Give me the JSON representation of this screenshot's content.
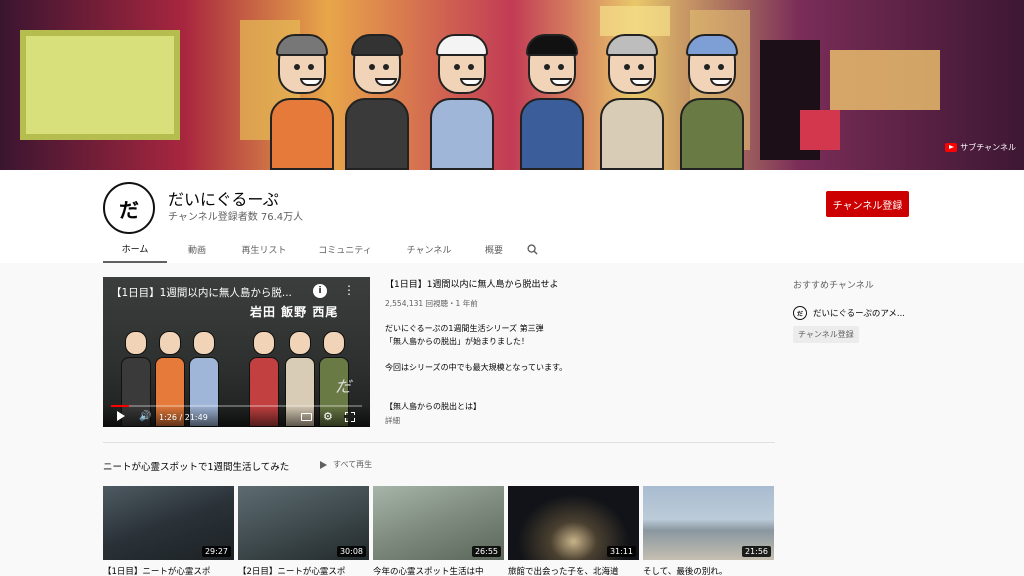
{
  "banner": {
    "sub_channel_label": "サブチャンネル"
  },
  "channel": {
    "name": "だいにぐるーぷ",
    "subscribers": "チャンネル登録者数 76.4万人",
    "subscribe_label": "チャンネル登録",
    "avatar_text": "だ"
  },
  "tabs": [
    {
      "label": "ホーム",
      "active": true
    },
    {
      "label": "動画"
    },
    {
      "label": "再生リスト"
    },
    {
      "label": "コミュニティ"
    },
    {
      "label": "チャンネル"
    },
    {
      "label": "概要"
    }
  ],
  "featured": {
    "overlay_title": "【1日目】1週間以内に無人島から脱...",
    "names": "岩田 飯野 西尾",
    "time": "1:26 / 21:49",
    "progress_fraction": 0.07,
    "title": "【1日目】1週間以内に無人島から脱出せよ",
    "meta": "2,554,131 回視聴・1 年前",
    "desc": [
      "だいにぐるーぷの1週間生活シリーズ 第三弾",
      "「無人島からの脱出」が始まりました！",
      "",
      "今回はシリーズの中でも最大規模となっています。",
      "",
      "",
      "【無人島からの脱出とは】"
    ],
    "more_label": "詳細"
  },
  "playlist": {
    "title": "ニートが心霊スポットで1週間生活してみた",
    "play_all": "すべて再生",
    "videos": [
      {
        "title": "【1日目】ニートが心霊スポ",
        "duration": "29:27"
      },
      {
        "title": "【2日目】ニートが心霊スポ",
        "duration": "30:08"
      },
      {
        "title": "今年の心霊スポット生活は中",
        "duration": "26:55"
      },
      {
        "title": "旅館で出会った子を、北海道",
        "duration": "31:11"
      },
      {
        "title": "そして、最後の別れ。",
        "duration": "21:56"
      }
    ]
  },
  "sidebar": {
    "title": "おすすめチャンネル",
    "channel_name": "だいにぐるーぷのアメ...",
    "subscribe_label": "チャンネル登録"
  },
  "colors": {
    "accent": "#cc0000",
    "text": "#030303",
    "muted": "#606060"
  }
}
